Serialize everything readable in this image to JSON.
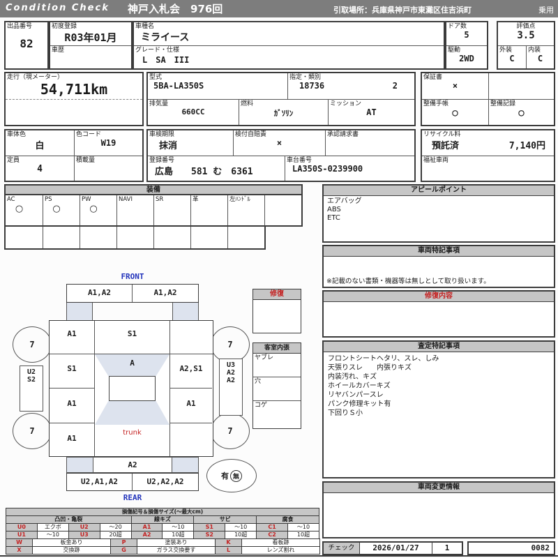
{
  "header": {
    "brand": "Condition  Check",
    "auction": "神戸入札会　976回",
    "pickup": "引取場所：兵庫県神戸市東灘区住吉浜町",
    "category": "乗用"
  },
  "info": {
    "lot": {
      "label": "出品番号",
      "value": "82"
    },
    "first_reg": {
      "label": "初度登録",
      "value": "R03年01月"
    },
    "history": {
      "label": "車歴",
      "value": ""
    },
    "model": {
      "label": "車種名",
      "value": "ミライース"
    },
    "grade": {
      "label": "グレード・仕様",
      "value": "L　SA　III"
    },
    "doors": {
      "label": "ドア数",
      "value": "5"
    },
    "drive": {
      "label": "駆動",
      "value": "2WD"
    },
    "score": {
      "label": "評価点",
      "value": "3.5"
    },
    "exterior": {
      "label": "外装",
      "value": "C"
    },
    "interior": {
      "label": "内装",
      "value": "C"
    },
    "mileage": {
      "label": "走行（現メーター）",
      "value": "54,711km"
    },
    "model_code": {
      "label": "型式",
      "value": "5BA-LA350S"
    },
    "class_no": {
      "label": "指定・類別",
      "value1": "18736",
      "value2": "2"
    },
    "displacement": {
      "label": "排気量",
      "value": "660CC"
    },
    "fuel": {
      "label": "燃料",
      "value": "ｶﾞｿﾘﾝ"
    },
    "mission": {
      "label": "ミッション",
      "value": "AT"
    },
    "warranty": {
      "label": "保証書",
      "value": "×"
    },
    "book": {
      "label": "整備手帳",
      "value": "○"
    },
    "record": {
      "label": "整備記録",
      "value": "○"
    },
    "body_color": {
      "label": "車体色",
      "value": "白"
    },
    "color_code": {
      "label": "色コード",
      "value": "W19"
    },
    "inspection": {
      "label": "車検期限",
      "value": "抹消"
    },
    "insurance": {
      "label": "検付自賠責",
      "value": "×"
    },
    "approval": {
      "label": "承認請求書",
      "value": ""
    },
    "recycle": {
      "label": "リサイクル料",
      "status": "預託済",
      "fee": "7,140円"
    },
    "capacity": {
      "label": "定員",
      "value": "4"
    },
    "load": {
      "label": "積載量",
      "value": ""
    },
    "reg_no": {
      "label": "登録番号",
      "value": "広島　　581 む　6361"
    },
    "chassis": {
      "label": "車台番号",
      "value": "LA350S-0239900"
    },
    "welfare": {
      "label": "福祉車両",
      "value": ""
    }
  },
  "equipment": {
    "title": "装備",
    "items": [
      {
        "label": "AC",
        "value": "○"
      },
      {
        "label": "PS",
        "value": "○"
      },
      {
        "label": "PW",
        "value": "○"
      },
      {
        "label": "NAVI",
        "value": ""
      },
      {
        "label": "SR",
        "value": ""
      },
      {
        "label": "革",
        "value": ""
      },
      {
        "label": "左ﾊﾝﾄﾞﾙ",
        "value": ""
      },
      {
        "label": "",
        "value": ""
      }
    ]
  },
  "middle": {
    "repair": {
      "title": "修復"
    },
    "cabin": {
      "title": "客室内張",
      "rows": [
        "ヤブレ",
        "穴",
        "コゲ"
      ]
    }
  },
  "panels": {
    "appeal": {
      "title": "アピールポイント",
      "lines": [
        "エアバッグ",
        "ABS",
        "ETC"
      ]
    },
    "vehicle_notes": {
      "title": "車両特記事項",
      "note": "※記載のない書類・機器等は無しとして取り扱います。"
    },
    "repair_content": {
      "title": "修復内容"
    },
    "assessment": {
      "title": "査定特記事項",
      "lines": [
        "フロントシートヘタリ、スレ、しみ",
        "天張りスレ　　内張りキズ",
        "内装汚れ、キズ",
        "ホイールカバーキズ",
        "リヤバンパースレ",
        "パンク修理キット有",
        "下回りＳ小"
      ]
    },
    "change_info": {
      "title": "車両変更情報"
    },
    "check": {
      "label": "チェック",
      "date": "2026/01/27",
      "count": "1",
      "number": "0082"
    }
  },
  "diagram": {
    "front_label": "FRONT",
    "rear_label": "REAR",
    "front_strip": [
      "A1,A2",
      "A1,A2"
    ],
    "left_col": [
      "A1",
      "S1",
      "A1",
      "A1"
    ],
    "center_top": "S1",
    "windshield": "A",
    "right_col": [
      "",
      "A2,S1",
      "A1",
      ""
    ],
    "left_side_box": [
      "U2",
      "S2"
    ],
    "right_side_box": [
      "U3",
      "A2",
      "A2"
    ],
    "trunk": "trunk",
    "rear_strip": "A2",
    "rear_bumper": [
      "U2,A1,A2",
      "U2,A2,A2"
    ],
    "wheels": [
      "7",
      "7",
      "7",
      "7"
    ],
    "spare": {
      "text": "有",
      "circled": "無"
    }
  },
  "legend": {
    "title": "損傷記号＆損傷サイズ(～最大cm)",
    "groups": [
      "凸凹・亀裂",
      "線キズ",
      "サビ",
      "腐食"
    ],
    "row1": [
      {
        "code": "U0",
        "desc": "エクボ"
      },
      {
        "code": "U2",
        "desc": "～20"
      },
      {
        "code": "A1",
        "desc": "～10"
      },
      {
        "code": "S1",
        "desc": "～10"
      },
      {
        "code": "C1",
        "desc": "～10"
      }
    ],
    "row2": [
      {
        "code": "U1",
        "desc": "～10"
      },
      {
        "code": "U3",
        "desc": "20超"
      },
      {
        "code": "A2",
        "desc": "10超"
      },
      {
        "code": "S2",
        "desc": "10超"
      },
      {
        "code": "C2",
        "desc": "10超"
      }
    ],
    "marks_row1": [
      {
        "code": "W",
        "desc": "板金あり"
      },
      {
        "code": "P",
        "desc": "塗装あり"
      },
      {
        "code": "K",
        "desc": "看板跡"
      }
    ],
    "marks_row2": [
      {
        "code": "X",
        "desc": "交換跡"
      },
      {
        "code": "G",
        "desc": "ガラス交換要す"
      },
      {
        "code": "L",
        "desc": "レンズ割れ"
      }
    ]
  }
}
